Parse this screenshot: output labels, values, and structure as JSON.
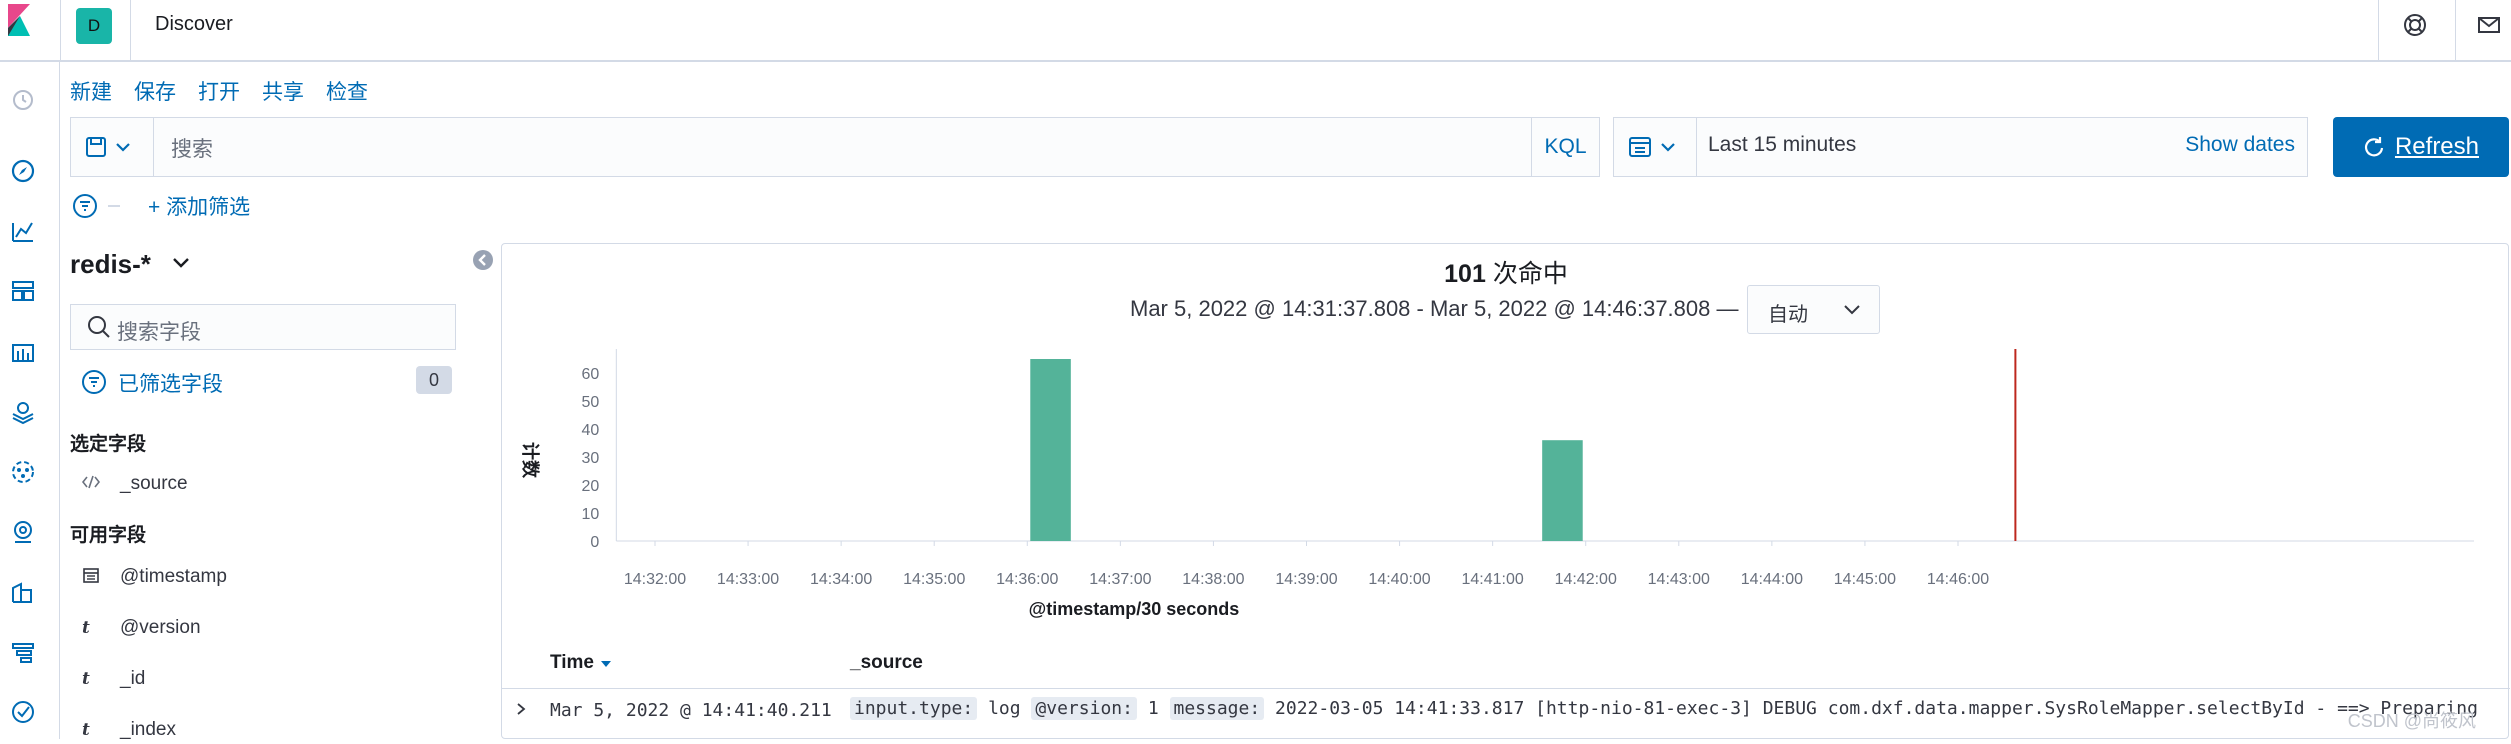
{
  "header": {
    "space_initial": "D",
    "title": "Discover"
  },
  "menu": {
    "new": "新建",
    "save": "保存",
    "open": "打开",
    "share": "共享",
    "inspect": "检查"
  },
  "query": {
    "placeholder": "搜索",
    "language": "KQL"
  },
  "date": {
    "range": "Last 15 minutes",
    "show_dates": "Show dates"
  },
  "refresh_label": "Refresh",
  "filter": {
    "add_label": "+ 添加筛选"
  },
  "sidebar": {
    "index_pattern": "redis-*",
    "search_placeholder": "搜索字段",
    "filtered_fields_label": "已筛选字段",
    "filtered_fields_count": "0",
    "selected_title": "选定字段",
    "selected_fields": [
      {
        "type": "</>",
        "name": "_source"
      }
    ],
    "available_title": "可用字段",
    "available_fields": [
      {
        "type": "calendar",
        "name": "@timestamp"
      },
      {
        "type": "t",
        "name": "@version"
      },
      {
        "type": "t",
        "name": "_id"
      },
      {
        "type": "t",
        "name": "_index"
      }
    ]
  },
  "hits": {
    "count": "101",
    "label": "次命中"
  },
  "time_range": "Mar 5, 2022 @ 14:31:37.808 - Mar 5, 2022 @ 14:46:37.808 —",
  "interval": "自动",
  "chart_data": {
    "type": "bar",
    "ylabel": "计数",
    "xlabel": "@timestamp/30 seconds",
    "ylim": [
      0,
      65
    ],
    "yticks": [
      0,
      10,
      20,
      30,
      40,
      50,
      60
    ],
    "xticks": [
      "14:32:00",
      "14:33:00",
      "14:34:00",
      "14:35:00",
      "14:36:00",
      "14:37:00",
      "14:38:00",
      "14:39:00",
      "14:40:00",
      "14:41:00",
      "14:42:00",
      "14:43:00",
      "14:44:00",
      "14:45:00",
      "14:46:00"
    ],
    "x_start_min": 14.31,
    "series": [
      {
        "values": [
          {
            "x": "14:36:00",
            "y": 65
          },
          {
            "x": "14:41:30",
            "y": 36
          }
        ]
      }
    ],
    "bar_color": "#54b399",
    "now_marker": "14:46:37",
    "grid": false
  },
  "table": {
    "col_time": "Time",
    "col_source": "_source",
    "rows": [
      {
        "time": "Mar 5, 2022 @ 14:41:40.211",
        "k1": "input.type:",
        "v1": "log",
        "k2": "@version:",
        "v2": "1",
        "k3": "message:",
        "v3": "2022-03-05 14:41:33.817 [http-nio-81-exec-3] DEBUG com.dxf.data.mapper.SysRoleMapper.selectById - ==> Preparing"
      }
    ]
  },
  "watermark": "CSDN @尚筱风",
  "colors": {
    "accent": "#006bb4",
    "bar": "#54b399",
    "now_line": "#bd271e"
  }
}
